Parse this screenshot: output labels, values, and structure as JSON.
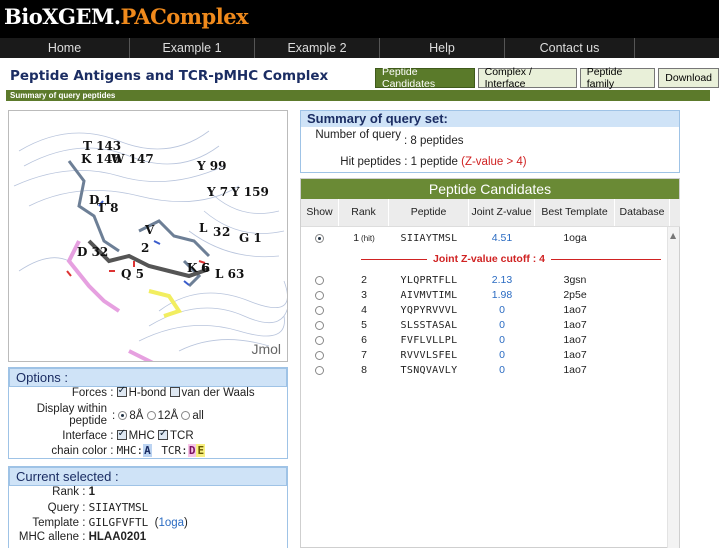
{
  "app": {
    "logo_main": "BioXGEM.",
    "logo_sub": "PAComplex"
  },
  "nav": [
    "Home",
    "Example 1",
    "Example 2",
    "Help",
    "Contact us"
  ],
  "page_title": "Peptide Antigens and TCR-pMHC Complex",
  "tabs": [
    "Peptide Candidates",
    "Complex / Interface",
    "Peptide family",
    "Download"
  ],
  "summary_strip": "Summary of query peptides",
  "viewer": {
    "jmol_label": "Jmol",
    "residue_labels": [
      "T 143",
      "K 146",
      "W 147",
      "Y 99",
      "Y 7",
      "Y 159",
      "D 1",
      "T 8",
      "V",
      "L",
      "3",
      "2",
      "G 1",
      "D 32",
      "Q 5",
      "2",
      "K 6",
      "6",
      "L 63"
    ]
  },
  "options": {
    "title": "Options :",
    "forces_label": "Forces",
    "hbond": "H-bond",
    "vdw": "van der Waals",
    "display_label": "Display within peptide",
    "dist_8": "8Å",
    "dist_12": "12Å",
    "dist_all": "all",
    "interface_label": "Interface",
    "mhc": "MHC",
    "tcr": "TCR",
    "chain_color_label": "chain color",
    "mhc_chain": "MHC:",
    "mhc_chain_id": "A",
    "tcr_chain": "TCR:",
    "tcr_chain_d": "D",
    "tcr_chain_e": "E"
  },
  "current": {
    "title": "Current selected :",
    "rank_label": "Rank",
    "rank": "1",
    "query_label": "Query",
    "query": "SIIAYTMSL",
    "template_label": "Template",
    "template": "GILGFVFTL",
    "template_link": "1oga",
    "allele_label": "MHC allene",
    "allele": "HLAA0201"
  },
  "summary": {
    "title": "Summary of query set:",
    "number_label": "Number of query",
    "number_value": "8 peptides",
    "hit_label": "Hit peptides",
    "hit_value": "1 peptide",
    "hit_note": "(Z-value > 4)"
  },
  "candidates": {
    "title": "Peptide Candidates",
    "columns": [
      "Show",
      "Rank",
      "Peptide",
      "Joint Z-value",
      "Best Template",
      "Database"
    ],
    "cutoff": "Joint Z-value cutoff : 4",
    "hit_tag": "(hit)",
    "rows": [
      {
        "rank": "1",
        "peptide": "SIIAYTMSL",
        "z": "4.51",
        "template": "1oga",
        "selected": true
      },
      {
        "rank": "2",
        "peptide": "YLQPRTFLL",
        "z": "2.13",
        "template": "3gsn",
        "selected": false
      },
      {
        "rank": "3",
        "peptide": "AIVMVTIML",
        "z": "1.98",
        "template": "2p5e",
        "selected": false
      },
      {
        "rank": "4",
        "peptide": "YQPYRVVVL",
        "z": "0",
        "template": "1ao7",
        "selected": false
      },
      {
        "rank": "5",
        "peptide": "SLSSTASAL",
        "z": "0",
        "template": "1ao7",
        "selected": false
      },
      {
        "rank": "6",
        "peptide": "FVFLVLLPL",
        "z": "0",
        "template": "1ao7",
        "selected": false
      },
      {
        "rank": "7",
        "peptide": "RVVVLSFEL",
        "z": "0",
        "template": "1ao7",
        "selected": false
      },
      {
        "rank": "8",
        "peptide": "TSNQVAVLY",
        "z": "0",
        "template": "1ao7",
        "selected": false
      }
    ]
  }
}
